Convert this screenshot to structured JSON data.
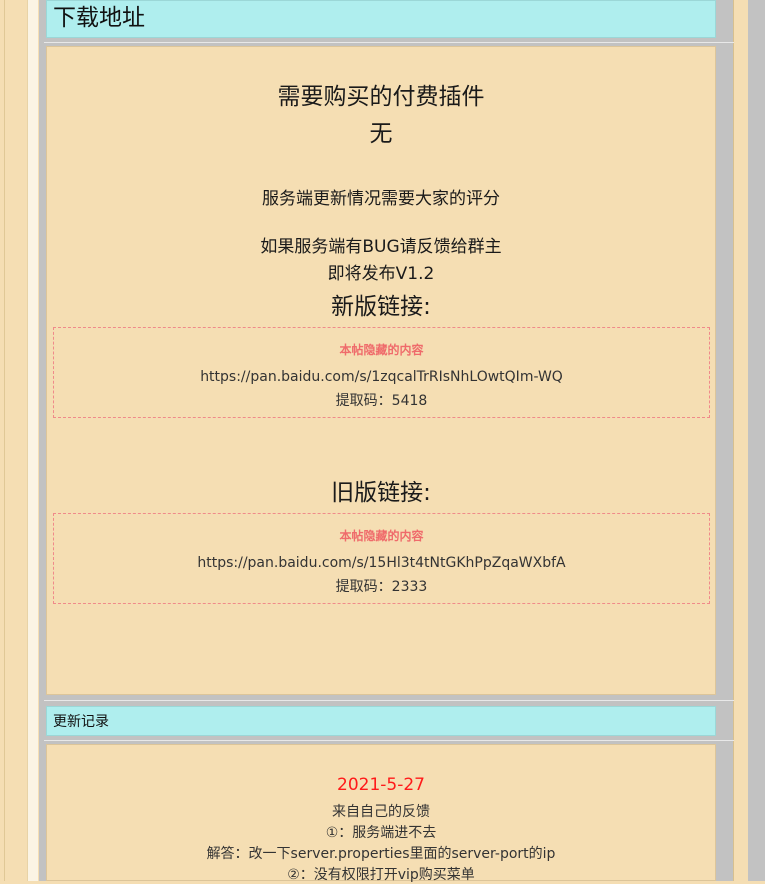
{
  "download_header": "下载地址",
  "download_panel": {
    "paid_plugins_title": "需要购买的付费插件",
    "paid_plugins_value": "无",
    "rating_note": "服务端更新情况需要大家的评分",
    "bug_note": "如果服务端有BUG请反馈给群主",
    "release_note": "即将发布V1.2",
    "new_link_title": "新版链接:",
    "new_hidden": {
      "label": "本帖隐藏的内容",
      "url": "https://pan.baidu.com/s/1zqcalTrRIsNhLOwtQIm-WQ",
      "code": "提取码：5418"
    },
    "old_link_title": "旧版链接:",
    "old_hidden": {
      "label": "本帖隐藏的内容",
      "url": "https://pan.baidu.com/s/15Hl3t4tNtGKhPpZqaWXbfA",
      "code": "提取码：2333"
    }
  },
  "changelog_header": "更新记录",
  "changelog": {
    "date": "2021-5-27",
    "source": "来自自己的反馈",
    "item1": "①：服务端进不去",
    "answer1": "解答：改一下server.properties里面的server-port的ip",
    "item2": "②：没有权限打开vip购买菜单"
  },
  "colors": {
    "page_bg": "#f5deb3",
    "header_bg": "#afeeee",
    "hidden_border": "#f08a8a",
    "date_red": "#ff1a1a"
  }
}
